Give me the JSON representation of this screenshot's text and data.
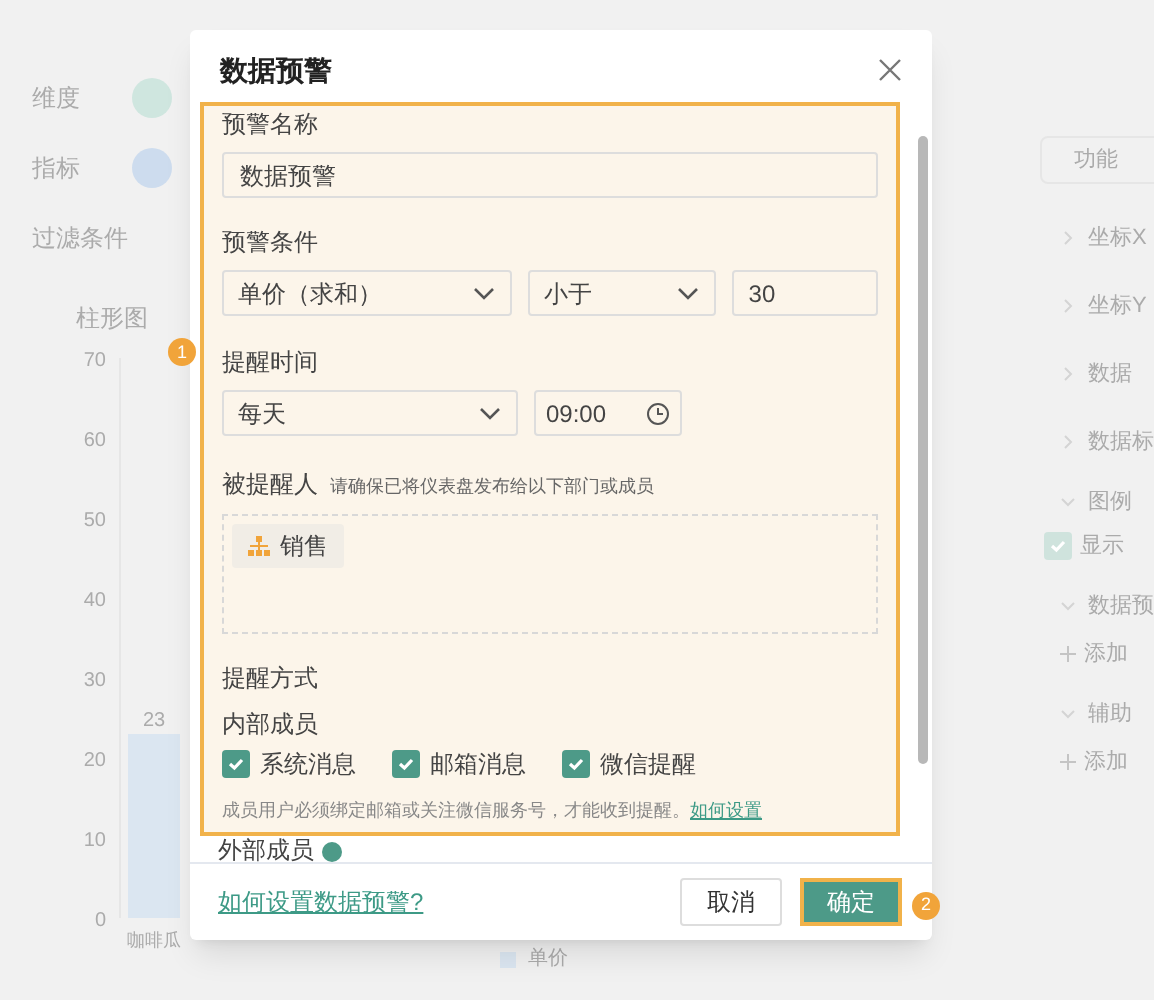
{
  "background": {
    "left_rows": [
      {
        "label": "维度",
        "color": "#cfe6df"
      },
      {
        "label": "指标",
        "color": "#cddcee"
      },
      {
        "label": "过滤条件"
      }
    ],
    "chart": {
      "title": "柱形图",
      "chart_data": {
        "type": "bar",
        "categories": [
          "咖啡瓜"
        ],
        "series": [
          {
            "name": "单价",
            "color": "#dbe6f1",
            "values": [
              23
            ]
          }
        ],
        "ylim": [
          0,
          70
        ],
        "yticks": [
          0,
          10,
          20,
          30,
          40,
          50,
          60,
          70
        ],
        "data_labels": true
      }
    },
    "right_button": "功能",
    "right_sections": [
      {
        "title": "坐标X",
        "expanded": false
      },
      {
        "title": "坐标Y",
        "expanded": false
      },
      {
        "title": "数据",
        "expanded": false
      },
      {
        "title": "数据标",
        "expanded": false
      },
      {
        "title": "图例",
        "expanded": true,
        "children": [
          {
            "kind": "checkbox",
            "label": "显示",
            "checked": true
          }
        ]
      },
      {
        "title": "数据预",
        "expanded": true,
        "children": [
          {
            "kind": "add",
            "label": "添加"
          }
        ]
      },
      {
        "title": "辅助",
        "expanded": true,
        "children": [
          {
            "kind": "add",
            "label": "添加"
          }
        ]
      }
    ]
  },
  "dialog": {
    "title": "数据预警",
    "step_badge": "1",
    "name_label": "预警名称",
    "name_value": "数据预警",
    "condition_label": "预警条件",
    "condition_field": "单价（求和）",
    "condition_operator": "小于",
    "condition_value": "30",
    "time_label": "提醒时间",
    "time_frequency": "每天",
    "time_value": "09:00",
    "recipient_label": "被提醒人",
    "recipient_hint": "请确保已将仪表盘发布给以下部门或成员",
    "recipients": [
      {
        "name": "销售"
      }
    ],
    "method_label": "提醒方式",
    "internal_label": "内部成员",
    "channels": [
      {
        "label": "系统消息",
        "checked": true
      },
      {
        "label": "邮箱消息",
        "checked": true
      },
      {
        "label": "微信提醒",
        "checked": true
      }
    ],
    "note": "成员用户必须绑定邮箱或关注微信服务号，才能收到提醒。",
    "note_link": "如何设置",
    "external_label": "外部成员",
    "help_link": "如何设置数据预警?",
    "cancel": "取消",
    "confirm": "确定",
    "confirm_badge": "2"
  }
}
